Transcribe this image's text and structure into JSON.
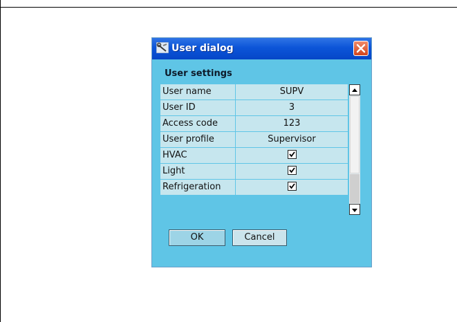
{
  "dialog": {
    "title": "User dialog",
    "section_title": "User settings",
    "rows": [
      {
        "label": "User name",
        "value": "SUPV",
        "type": "text"
      },
      {
        "label": "User ID",
        "value": "3",
        "type": "text"
      },
      {
        "label": "Access code",
        "value": "123",
        "type": "text"
      },
      {
        "label": "User profile",
        "value": "Supervisor",
        "type": "text"
      },
      {
        "label": "HVAC",
        "checked": true,
        "type": "checkbox"
      },
      {
        "label": "Light",
        "checked": true,
        "type": "checkbox"
      },
      {
        "label": "Refrigeration",
        "checked": true,
        "type": "checkbox"
      }
    ],
    "ok_label": "OK",
    "cancel_label": "Cancel"
  },
  "colors": {
    "dialog_bg": "#5fc5e6",
    "titlebar": "#0c55d8",
    "table_bg": "#c6e6ee",
    "close_button": "#d2441d"
  },
  "icons": {
    "app_icon": "tools-icon",
    "close_icon": "close-icon",
    "scroll_up": "scroll-up-arrow-icon",
    "scroll_down": "scroll-down-arrow-icon",
    "checkmark": "checkmark-icon"
  }
}
